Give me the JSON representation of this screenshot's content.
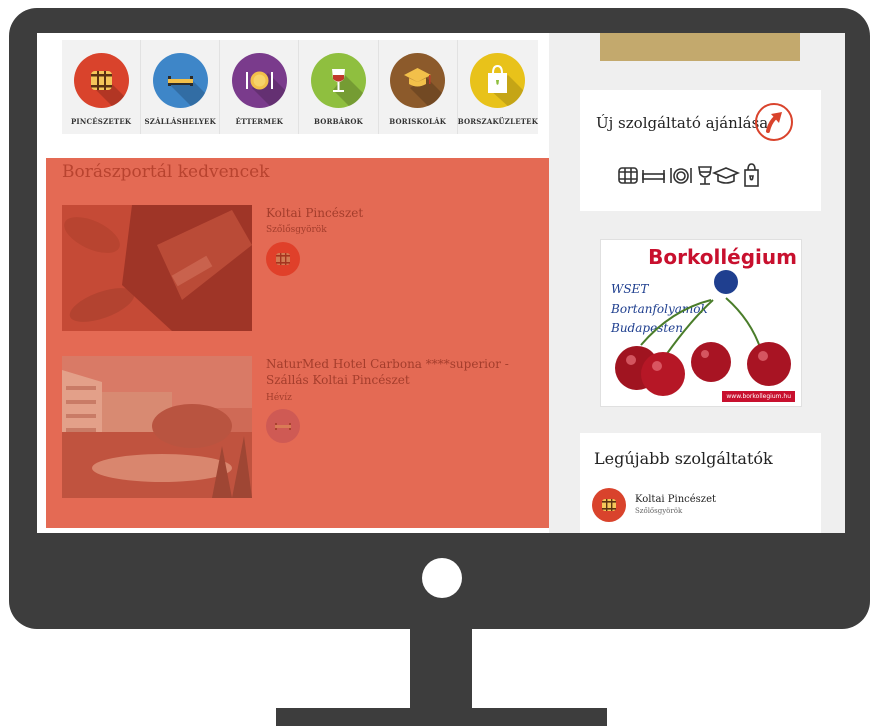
{
  "categories": [
    {
      "label": "PINCÉSZETEK",
      "icon": "barrel-icon",
      "color": "#d9432c"
    },
    {
      "label": "SZÁLLÁSHELYEK",
      "icon": "bed-icon",
      "color": "#3e86c8"
    },
    {
      "label": "ÉTTERMEK",
      "icon": "plate-icon",
      "color": "#7a3b8c"
    },
    {
      "label": "BORBÁROK",
      "icon": "wine-glass-icon",
      "color": "#8fbf3f"
    },
    {
      "label": "BORISKOLÁK",
      "icon": "graduation-cap-icon",
      "color": "#8c5a2b"
    },
    {
      "label": "BORSZAKÜZLETEK",
      "icon": "shopping-bag-icon",
      "color": "#e8c21a"
    }
  ],
  "favorites": {
    "title": "Borászportál kedvencek",
    "items": [
      {
        "name": "Koltai Pincészet",
        "place": "Szőlősgyörök",
        "icon": "barrel-icon"
      },
      {
        "name": "NaturMed Hotel Carbona ****superior - Szállás Koltai Pincészet",
        "place": "Hévíz",
        "icon": "bed-icon"
      }
    ]
  },
  "sidebar": {
    "recommend_title": "Új szolgáltató ajánlása",
    "recommend_icon": "arrow-up-icon",
    "ad": {
      "title": "Borkollégium",
      "line1": "WSET",
      "line2": "Bortanfolyamok",
      "line3": "Budapesten",
      "url": "www.borkollegium.hu"
    },
    "newest_title": "Legújabb szolgáltatók",
    "newest": {
      "name": "Koltai Pincészet",
      "place": "Szőlősgyörök"
    }
  },
  "colors": {
    "accent": "#d9432c",
    "monitor": "#3d3d3d",
    "overlay": "#e46a54"
  }
}
